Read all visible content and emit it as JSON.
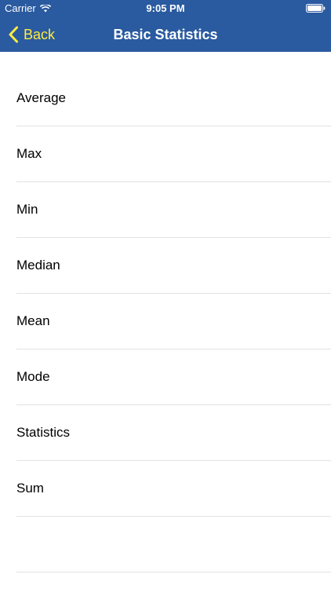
{
  "status": {
    "carrier": "Carrier",
    "time": "9:05 PM"
  },
  "nav": {
    "back_label": "Back",
    "title": "Basic Statistics"
  },
  "list": {
    "items": [
      {
        "label": "Average"
      },
      {
        "label": "Max"
      },
      {
        "label": "Min"
      },
      {
        "label": "Median"
      },
      {
        "label": "Mean"
      },
      {
        "label": "Mode"
      },
      {
        "label": "Statistics"
      },
      {
        "label": "Sum"
      }
    ]
  },
  "colors": {
    "header_bg": "#2a5aa0",
    "back_accent": "#ffec3d",
    "separator": "#e3e3e3"
  }
}
